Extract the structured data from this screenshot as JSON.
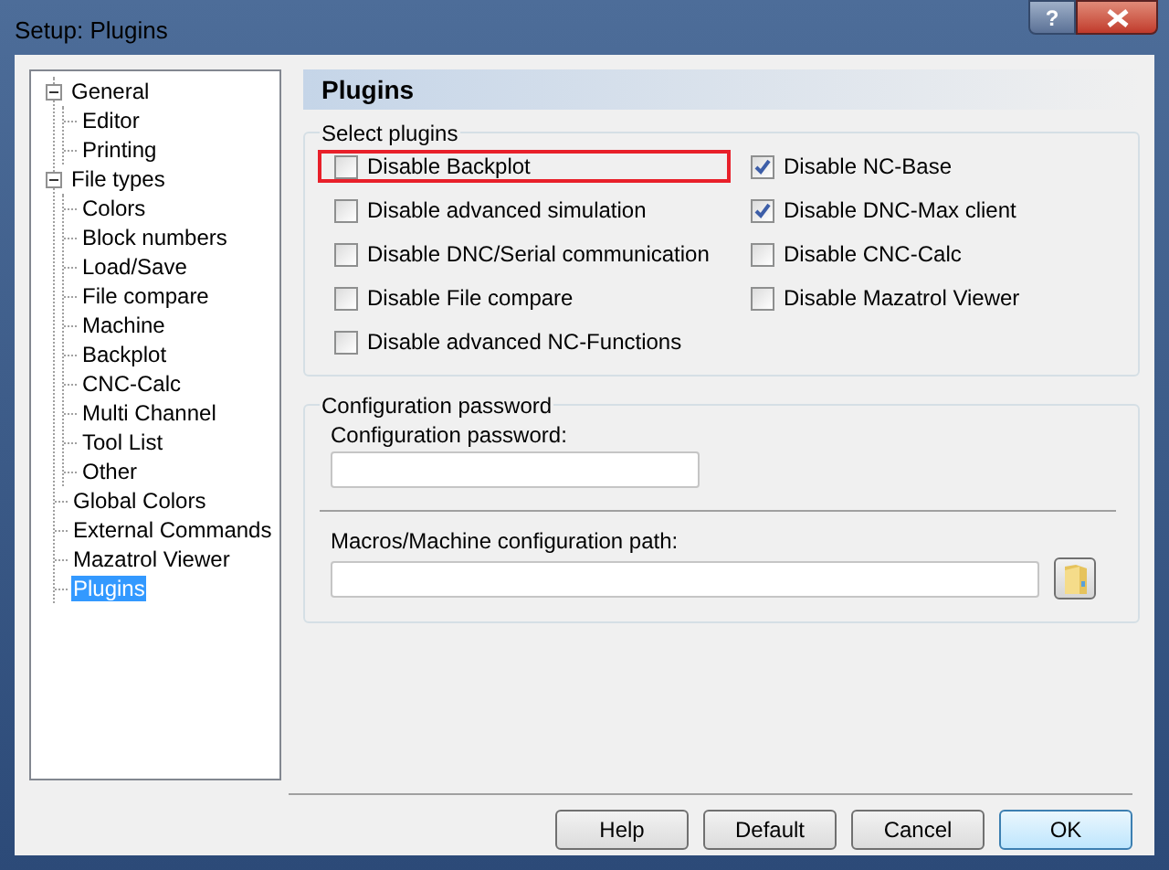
{
  "window": {
    "title": "Setup: Plugins",
    "help_button": "?"
  },
  "tree": [
    {
      "label": "General",
      "expanded": true,
      "selected": false,
      "children": [
        {
          "label": "Editor",
          "selected": false
        },
        {
          "label": "Printing",
          "selected": false
        }
      ]
    },
    {
      "label": "File types",
      "expanded": true,
      "selected": false,
      "children": [
        {
          "label": "Colors",
          "selected": false
        },
        {
          "label": "Block numbers",
          "selected": false
        },
        {
          "label": "Load/Save",
          "selected": false
        },
        {
          "label": "File compare",
          "selected": false
        },
        {
          "label": "Machine",
          "selected": false
        },
        {
          "label": "Backplot",
          "selected": false
        },
        {
          "label": "CNC-Calc",
          "selected": false
        },
        {
          "label": "Multi Channel",
          "selected": false
        },
        {
          "label": "Tool List",
          "selected": false
        },
        {
          "label": "Other",
          "selected": false
        }
      ]
    },
    {
      "label": "Global Colors",
      "selected": false
    },
    {
      "label": "External Commands",
      "selected": false
    },
    {
      "label": "Mazatrol Viewer",
      "selected": false
    },
    {
      "label": "Plugins",
      "selected": true
    }
  ],
  "page_title": "Plugins",
  "select_plugins": {
    "title": "Select plugins",
    "columns": [
      [
        {
          "label": "Disable Backplot",
          "checked": false,
          "highlighted": true
        },
        {
          "label": "Disable advanced simulation",
          "checked": false,
          "highlighted": false
        },
        {
          "label": "Disable DNC/Serial communication",
          "checked": false,
          "highlighted": false
        },
        {
          "label": "Disable File compare",
          "checked": false,
          "highlighted": false
        },
        {
          "label": "Disable advanced NC-Functions",
          "checked": false,
          "highlighted": false
        }
      ],
      [
        {
          "label": "Disable NC-Base",
          "checked": true,
          "highlighted": false
        },
        {
          "label": "Disable DNC-Max client",
          "checked": true,
          "highlighted": false
        },
        {
          "label": "Disable CNC-Calc",
          "checked": false,
          "highlighted": false
        },
        {
          "label": "Disable Mazatrol Viewer",
          "checked": false,
          "highlighted": false
        }
      ]
    ]
  },
  "configuration": {
    "title": "Configuration password",
    "password_label": "Configuration password:",
    "path_label": "Macros/Machine configuration path:"
  },
  "buttons": [
    {
      "label": "Help",
      "default": false
    },
    {
      "label": "Default",
      "default": false
    },
    {
      "label": "Cancel",
      "default": false
    },
    {
      "label": "OK",
      "default": true
    }
  ]
}
